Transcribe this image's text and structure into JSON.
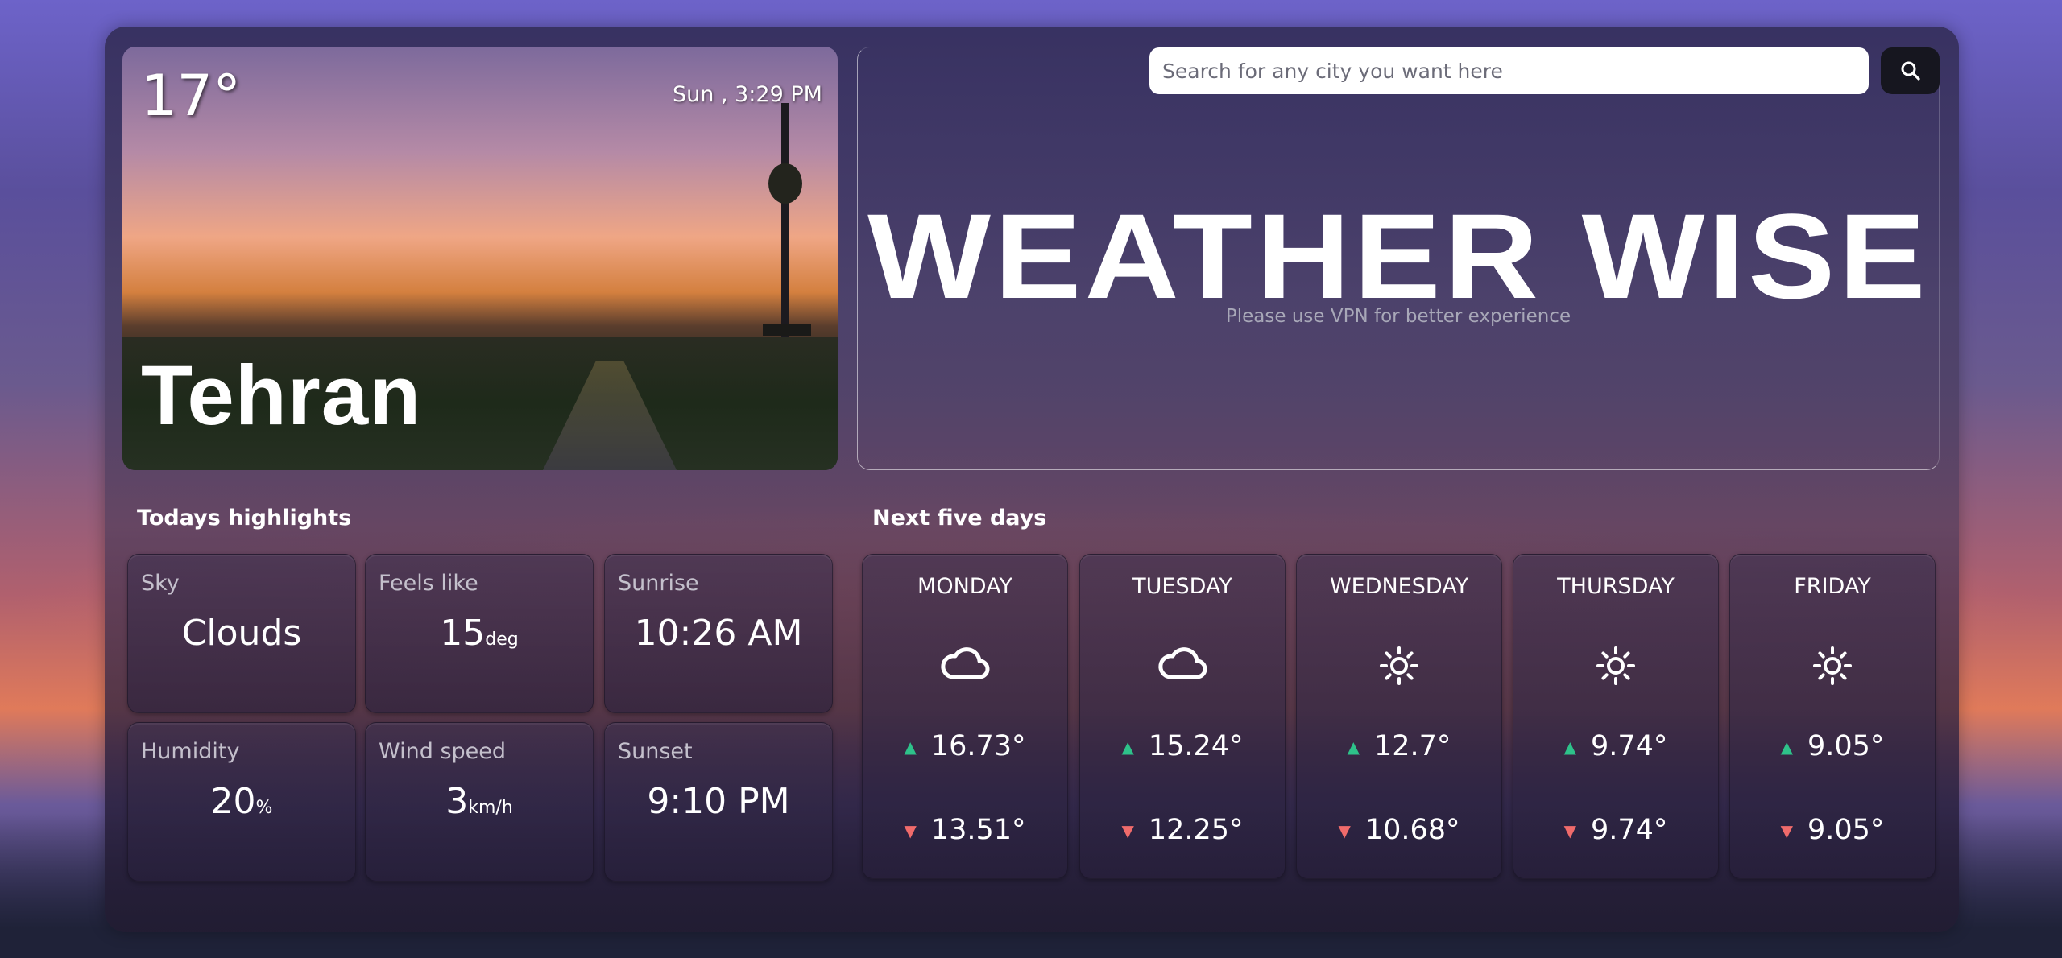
{
  "current": {
    "temperature": "17°",
    "datetime": "Sun , 3:29 PM",
    "city": "Tehran"
  },
  "search": {
    "placeholder": "Search for any city you want here",
    "icon": "search-icon"
  },
  "hero": {
    "title": "WEATHER WISE",
    "subtitle": "Please use VPN for better experience"
  },
  "highlights": {
    "heading": "Todays highlights",
    "items": [
      {
        "label": "Sky",
        "value": "Clouds",
        "unit": ""
      },
      {
        "label": "Feels like",
        "value": "15",
        "unit": "deg"
      },
      {
        "label": "Sunrise",
        "value": "10:26 AM",
        "unit": ""
      },
      {
        "label": "Humidity",
        "value": "20",
        "unit": "%"
      },
      {
        "label": "Wind speed",
        "value": "3",
        "unit": "km/h"
      },
      {
        "label": "Sunset",
        "value": "9:10 PM",
        "unit": ""
      }
    ]
  },
  "forecast": {
    "heading": "Next five days",
    "days": [
      {
        "name": "MONDAY",
        "icon": "cloud-icon",
        "high": "16.73°",
        "low": "13.51°"
      },
      {
        "name": "TUESDAY",
        "icon": "cloud-icon",
        "high": "15.24°",
        "low": "12.25°"
      },
      {
        "name": "WEDNESDAY",
        "icon": "sun-icon",
        "high": "12.7°",
        "low": "10.68°"
      },
      {
        "name": "THURSDAY",
        "icon": "sun-icon",
        "high": "9.74°",
        "low": "9.74°"
      },
      {
        "name": "FRIDAY",
        "icon": "sun-icon",
        "high": "9.05°",
        "low": "9.05°"
      }
    ]
  },
  "colors": {
    "up": "#2ec28a",
    "down": "#f06b6b",
    "search_button": "#16161f"
  }
}
